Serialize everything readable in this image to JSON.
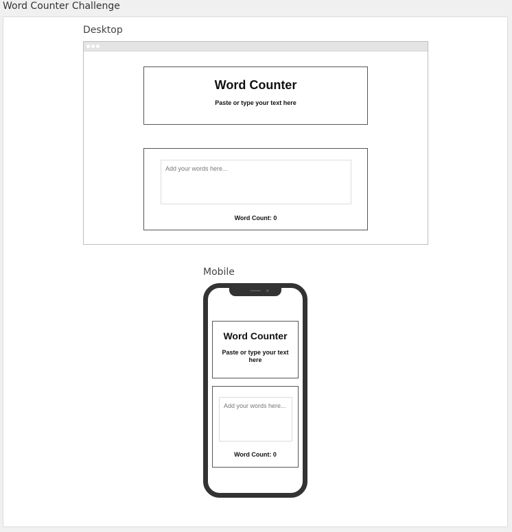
{
  "page": {
    "title": "Word Counter Challenge"
  },
  "desktop": {
    "label": "Desktop",
    "header": {
      "title": "Word Counter",
      "subtitle": "Paste or type your text here"
    },
    "input": {
      "placeholder": "Add your words here..."
    },
    "word_count": "Word Count: 0"
  },
  "mobile": {
    "label": "Mobile",
    "header": {
      "title": "Word Counter",
      "subtitle": "Paste or type your text here"
    },
    "input": {
      "placeholder": "Add your words here..."
    },
    "word_count": "Word Count: 0"
  },
  "colors": {
    "frame_border": "#555555",
    "phone_body": "#333333",
    "background": "#f0f0f0"
  }
}
